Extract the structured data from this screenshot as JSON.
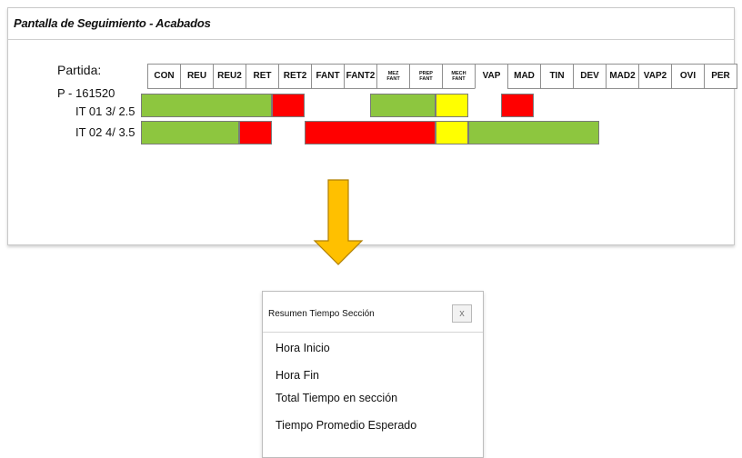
{
  "panel": {
    "title": "Pantalla de Seguimiento - Acabados",
    "partida_label": "Partida:",
    "lot_label": "P - 161520",
    "rows": [
      {
        "label": "IT 01  3/ 2.5"
      },
      {
        "label": "IT 02  4/ 3.5"
      }
    ]
  },
  "columns": [
    {
      "key": "CON",
      "label": "CON"
    },
    {
      "key": "REU",
      "label": "REU"
    },
    {
      "key": "REU2",
      "label": "REU2"
    },
    {
      "key": "RET",
      "label": "RET"
    },
    {
      "key": "RET2",
      "label": "RET2"
    },
    {
      "key": "FANT",
      "label": "FANT"
    },
    {
      "key": "FANT2",
      "label": "FANT2"
    },
    {
      "key": "MEZFANT",
      "line1": "MEZ",
      "line2": "FANT"
    },
    {
      "key": "PREPFANT",
      "line1": "PREP",
      "line2": "FANT"
    },
    {
      "key": "MECHFANT",
      "line1": "MECH",
      "line2": "FANT"
    },
    {
      "key": "VAP",
      "label": "VAP"
    },
    {
      "key": "MAD",
      "label": "MAD"
    },
    {
      "key": "TIN",
      "label": "TIN"
    },
    {
      "key": "DEV",
      "label": "DEV"
    },
    {
      "key": "MAD2",
      "label": "MAD2"
    },
    {
      "key": "VAP2",
      "label": "VAP2"
    },
    {
      "key": "OVI",
      "label": "OVI"
    },
    {
      "key": "PER",
      "label": "PER"
    }
  ],
  "status_colors": {
    "green": "#8dc63f",
    "red": "#ff0000",
    "yellow": "#ffff00"
  },
  "row_status": [
    [
      {
        "from": "CON",
        "to": "RET",
        "status": "green"
      },
      {
        "from": "RET2",
        "to": "RET2",
        "status": "red"
      },
      {
        "from": "MEZFANT",
        "to": "PREPFANT",
        "status": "green"
      },
      {
        "from": "MECHFANT",
        "to": "MECHFANT",
        "status": "yellow"
      },
      {
        "from": "MAD",
        "to": "MAD",
        "status": "red"
      }
    ],
    [
      {
        "from": "CON",
        "to": "REU2",
        "status": "green"
      },
      {
        "from": "RET",
        "to": "RET",
        "status": "red"
      },
      {
        "from": "FANT",
        "to": "PREPFANT",
        "status": "red"
      },
      {
        "from": "MECHFANT",
        "to": "MECHFANT",
        "status": "yellow"
      },
      {
        "from": "VAP",
        "to": "DEV",
        "status": "green"
      }
    ]
  ],
  "dialog": {
    "title": "Resumen Tiempo Sección",
    "close_label": "x",
    "items": [
      {
        "label": "Hora Inicio"
      },
      {
        "label": "Hora Fin"
      },
      {
        "label": "Total Tiempo en sección"
      },
      {
        "label": "Tiempo Promedio Esperado"
      }
    ]
  },
  "arrow_color": "#ffc000"
}
